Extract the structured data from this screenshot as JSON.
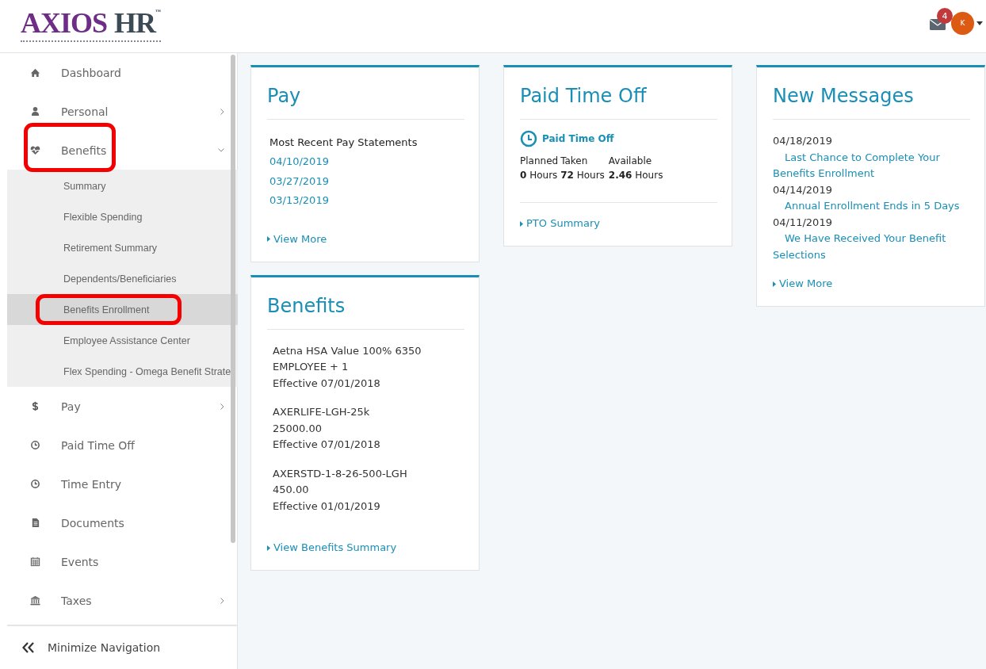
{
  "header": {
    "logo": {
      "primary": "AXIOS",
      "secondary": "HR",
      "mark": "™"
    },
    "mail_badge": "4",
    "avatar": "K"
  },
  "sidebar": {
    "items": [
      {
        "label": "Dashboard",
        "selected": false,
        "annotated": false
      },
      {
        "label": "Personal",
        "selected": false,
        "annotated": false,
        "expanded": false
      },
      {
        "label": "Benefits",
        "selected": false,
        "annotated": true,
        "expanded": true,
        "children": [
          {
            "label": "Summary",
            "selected": false,
            "annotated": false
          },
          {
            "label": "Flexible Spending",
            "selected": false,
            "annotated": false
          },
          {
            "label": "Retirement Summary",
            "selected": false,
            "annotated": false
          },
          {
            "label": "Dependents/Beneficiaries",
            "selected": false,
            "annotated": false
          },
          {
            "label": "Benefits Enrollment",
            "selected": true,
            "annotated": true
          },
          {
            "label": "Employee Assistance Center",
            "selected": false,
            "annotated": false
          },
          {
            "label": "Flex Spending - Omega Benefit Strate",
            "selected": false,
            "annotated": false
          }
        ]
      },
      {
        "label": "Pay",
        "selected": false,
        "annotated": false,
        "expanded": false
      },
      {
        "label": "Paid Time Off",
        "selected": false,
        "annotated": false
      },
      {
        "label": "Time Entry",
        "selected": false,
        "annotated": false
      },
      {
        "label": "Documents",
        "selected": false,
        "annotated": false
      },
      {
        "label": "Events",
        "selected": false,
        "annotated": false
      },
      {
        "label": "Taxes",
        "selected": false,
        "annotated": false,
        "expanded": false
      }
    ],
    "footer": "Minimize Navigation"
  },
  "cards": [
    {
      "kind": "pay",
      "title": "Pay",
      "subtitle": "Most Recent Pay Statements",
      "links": [
        "04/10/2019",
        "03/27/2019",
        "03/13/2019"
      ],
      "footer_link": "View More"
    },
    {
      "kind": "pto",
      "title": "Paid Time Off",
      "subtitle": "Paid Time Off",
      "columns": [
        {
          "header": "Planned",
          "value": "**0** Hours"
        },
        {
          "header": "Taken",
          "value": "**72** Hours"
        },
        {
          "header": "Available",
          "value": "**2.46** Hours"
        }
      ],
      "footer_link": "PTO Summary"
    },
    {
      "kind": "messages",
      "title": "New Messages",
      "messages": [
        {
          "date": "04/18/2019",
          "subject": "Last Chance to Complete Your Benefits Enrollment"
        },
        {
          "date": "04/14/2019",
          "subject": "Annual Enrollment Ends in 5 Days"
        },
        {
          "date": "04/11/2019",
          "subject": "We Have Received Your Benefit Selections"
        }
      ],
      "footer_link": "View More"
    },
    {
      "kind": "benefits",
      "title": "Benefits",
      "plans": [
        {
          "lines": [
            "Aetna HSA Value 100% 6350",
            "EMPLOYEE + 1",
            "Effective 07/01/2018"
          ]
        },
        {
          "lines": [
            "AXERLIFE-LGH-25k",
            "25000.00",
            "Effective 07/01/2018"
          ]
        },
        {
          "lines": [
            "AXERSTD-1-8-26-500-LGH",
            "450.00",
            "Effective 01/01/2019"
          ]
        }
      ],
      "footer_link": "View Benefits Summary"
    }
  ]
}
